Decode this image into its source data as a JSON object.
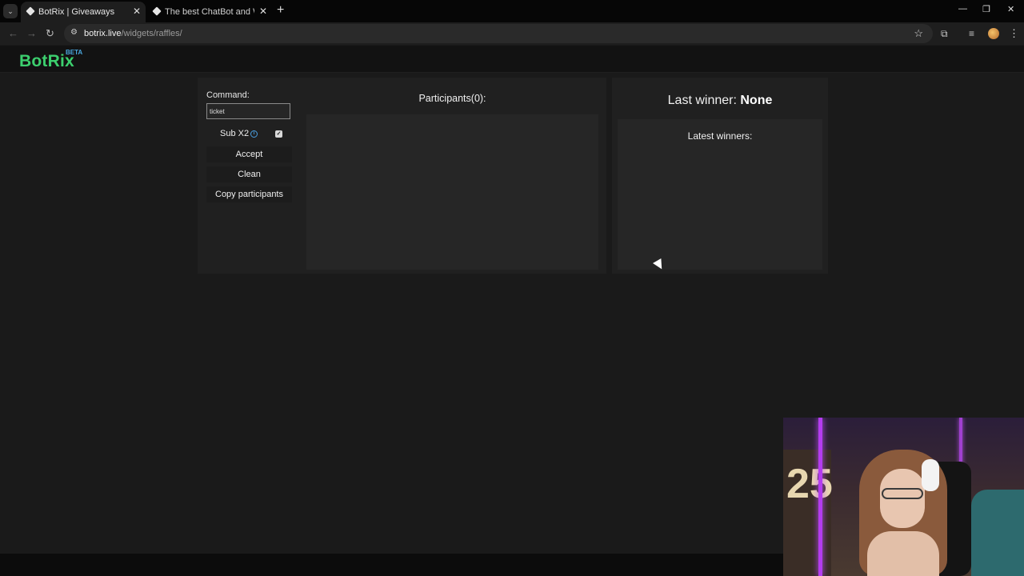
{
  "browser": {
    "tabs": [
      {
        "title": "BotRix | Giveaways",
        "active": true
      },
      {
        "title": "The best ChatBot and Widgets",
        "active": false
      }
    ],
    "url_host": "botrix.live",
    "url_path": "/widgets/raffles/",
    "window_controls": {
      "minimize": "—",
      "restore": "❐",
      "close": "✕"
    }
  },
  "app": {
    "logo": "BotRix",
    "badge": "BETA"
  },
  "raffle": {
    "command_label": "Command:",
    "command_value": "ticket",
    "sub_label": "Sub X2",
    "sub_checked": true,
    "buttons": {
      "accept": "Accept",
      "clean": "Clean",
      "copy": "Copy participants"
    },
    "participants_title": "Participants(0):"
  },
  "winners": {
    "last_winner_label": "Last winner: ",
    "last_winner_value": "None",
    "latest_title": "Latest winners:"
  },
  "colors": {
    "brand_green": "#3ccf6e",
    "beta_blue": "#4aa8e0",
    "panel_bg": "#202020",
    "page_bg": "#1a1a1a"
  },
  "webcam": {
    "balloon_text": "25"
  }
}
